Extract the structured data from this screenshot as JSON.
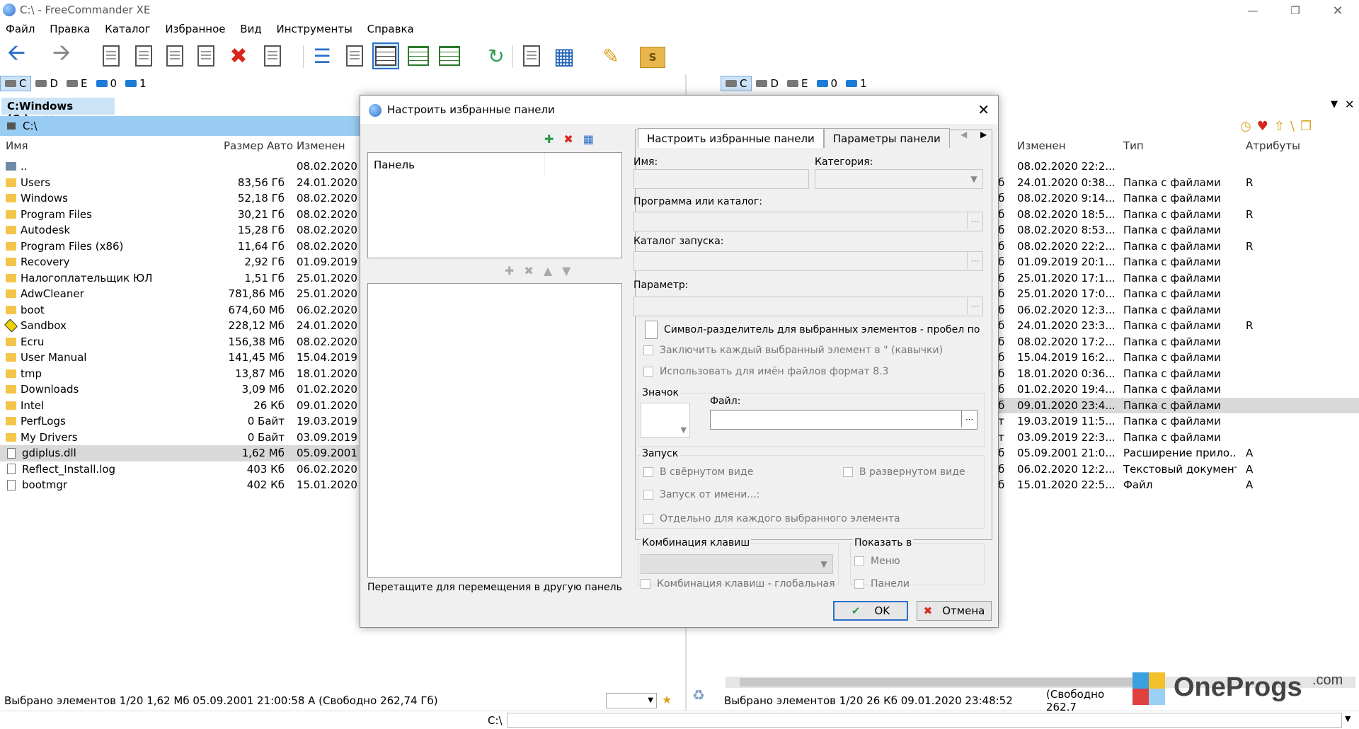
{
  "window": {
    "title": "C:\\ - FreeCommander XE"
  },
  "menu": [
    "Файл",
    "Правка",
    "Каталог",
    "Избранное",
    "Вид",
    "Инструменты",
    "Справка"
  ],
  "drives": [
    "C",
    "D",
    "E",
    "0",
    "1"
  ],
  "left_panel": {
    "tab": "C:Windows (C:)",
    "path": "C:\\",
    "headers": {
      "name": "Имя",
      "size": "Размер Авто",
      "modified": "Изменен"
    },
    "rows": [
      {
        "name": "..",
        "size": "",
        "date": "08.02.2020",
        "type": "up"
      },
      {
        "name": "Users",
        "size": "83,56 Гб",
        "date": "24.01.2020",
        "type": "folder"
      },
      {
        "name": "Windows",
        "size": "52,18 Гб",
        "date": "08.02.2020",
        "type": "folder"
      },
      {
        "name": "Program Files",
        "size": "30,21 Гб",
        "date": "08.02.2020",
        "type": "folder"
      },
      {
        "name": "Autodesk",
        "size": "15,28 Гб",
        "date": "08.02.2020",
        "type": "folder"
      },
      {
        "name": "Program Files (x86)",
        "size": "11,64 Гб",
        "date": "08.02.2020",
        "type": "folder"
      },
      {
        "name": "Recovery",
        "size": "2,92 Гб",
        "date": "01.09.2019",
        "type": "folder"
      },
      {
        "name": "Налогоплательщик ЮЛ",
        "size": "1,51 Гб",
        "date": "25.01.2020",
        "type": "folder"
      },
      {
        "name": "AdwCleaner",
        "size": "781,86 Мб",
        "date": "25.01.2020",
        "type": "folder"
      },
      {
        "name": "boot",
        "size": "674,60 Мб",
        "date": "06.02.2020",
        "type": "folder"
      },
      {
        "name": "Sandbox",
        "size": "228,12 Мб",
        "date": "24.01.2020",
        "type": "sandbox"
      },
      {
        "name": "Ecru",
        "size": "156,38 Мб",
        "date": "08.02.2020",
        "type": "folder"
      },
      {
        "name": "User Manual",
        "size": "141,45 Мб",
        "date": "15.04.2019",
        "type": "folder"
      },
      {
        "name": "tmp",
        "size": "13,87 Мб",
        "date": "18.01.2020",
        "type": "folder"
      },
      {
        "name": "Downloads",
        "size": "3,09 Мб",
        "date": "01.02.2020",
        "type": "folder"
      },
      {
        "name": "Intel",
        "size": "26 Кб",
        "date": "09.01.2020",
        "type": "folder"
      },
      {
        "name": "PerfLogs",
        "size": "0 Байт",
        "date": "19.03.2019",
        "type": "folder"
      },
      {
        "name": "My Drivers",
        "size": "0 Байт",
        "date": "03.09.2019",
        "type": "folder"
      },
      {
        "name": "gdiplus.dll",
        "size": "1,62 Мб",
        "date": "05.09.2001",
        "type": "file"
      },
      {
        "name": "Reflect_Install.log",
        "size": "403 Кб",
        "date": "06.02.2020",
        "type": "file"
      },
      {
        "name": "bootmgr",
        "size": "402 Кб",
        "date": "15.01.2020",
        "type": "file"
      }
    ],
    "status": "Выбрано элементов 1/20   1,62 Мб   05.09.2001 21:00:58   A   (Свободно 262,74 Гб)"
  },
  "right_panel": {
    "headers": {
      "mod": "Изменен",
      "type": "Тип",
      "attr": "Атрибуты"
    },
    "rows": [
      {
        "c": "",
        "date": "08.02.2020 22:2...",
        "type": "",
        "attr": ""
      },
      {
        "c": "б",
        "date": "24.01.2020 0:38...",
        "type": "Папка с файлами",
        "attr": "R"
      },
      {
        "c": "б",
        "date": "08.02.2020 9:14...",
        "type": "Папка с файлами",
        "attr": ""
      },
      {
        "c": "б",
        "date": "08.02.2020 18:5...",
        "type": "Папка с файлами",
        "attr": "R"
      },
      {
        "c": "б",
        "date": "08.02.2020 8:53...",
        "type": "Папка с файлами",
        "attr": ""
      },
      {
        "c": "б",
        "date": "08.02.2020 22:2...",
        "type": "Папка с файлами",
        "attr": "R"
      },
      {
        "c": "б",
        "date": "01.09.2019 20:1...",
        "type": "Папка с файлами",
        "attr": ""
      },
      {
        "c": "б",
        "date": "25.01.2020 17:1...",
        "type": "Папка с файлами",
        "attr": ""
      },
      {
        "c": "б",
        "date": "25.01.2020 17:0...",
        "type": "Папка с файлами",
        "attr": ""
      },
      {
        "c": "б",
        "date": "06.02.2020 12:3...",
        "type": "Папка с файлами",
        "attr": ""
      },
      {
        "c": "б",
        "date": "24.01.2020 23:3...",
        "type": "Папка с файлами",
        "attr": "R"
      },
      {
        "c": "б",
        "date": "08.02.2020 17:2...",
        "type": "Папка с файлами",
        "attr": ""
      },
      {
        "c": "б",
        "date": "15.04.2019 16:2...",
        "type": "Папка с файлами",
        "attr": ""
      },
      {
        "c": "б",
        "date": "18.01.2020 0:36...",
        "type": "Папка с файлами",
        "attr": ""
      },
      {
        "c": "б",
        "date": "01.02.2020 19:4...",
        "type": "Папка с файлами",
        "attr": ""
      },
      {
        "c": "б",
        "date": "09.01.2020 23:4...",
        "type": "Папка с файлами",
        "attr": ""
      },
      {
        "c": "т",
        "date": "19.03.2019 11:5...",
        "type": "Папка с файлами",
        "attr": ""
      },
      {
        "c": "т",
        "date": "03.09.2019 22:3...",
        "type": "Папка с файлами",
        "attr": ""
      },
      {
        "c": "б",
        "date": "05.09.2001 21:0...",
        "type": "Расширение прило...",
        "attr": "A"
      },
      {
        "c": "б",
        "date": "06.02.2020 12:2...",
        "type": "Текстовый документ",
        "attr": "A"
      },
      {
        "c": "б",
        "date": "15.01.2020 22:5...",
        "type": "Файл",
        "attr": "A"
      }
    ],
    "status": "Выбрано элементов 1/20   26 Кб   09.01.2020 23:48:52",
    "free": "(Свободно 262,7"
  },
  "bottom_path": "C:\\",
  "dialog": {
    "title": "Настроить избранные панели",
    "panel_col": "Панель",
    "hint": "Перетащите для перемещения в другую панель",
    "tabs": [
      "Настроить избранные панели",
      "Параметры панели"
    ],
    "name_label": "Имя:",
    "category_label": "Категория:",
    "program_label": "Программа или каталог:",
    "startdir_label": "Каталог запуска:",
    "param_label": "Параметр:",
    "chk_sep": "Символ-разделитель для выбранных элементов - пробел по умол",
    "chk_quotes": "Заключить каждый выбранный элемент в \" (кавычки)",
    "chk_83": "Использовать для имён файлов формат 8.3",
    "icon_label": "Значок",
    "file_label": "Файл:",
    "launch_label": "Запуск",
    "chk_min": "В свёрнутом виде",
    "chk_max": "В развернутом виде",
    "chk_runas": "Запуск от имени...:",
    "chk_each": "Отдельно для каждого выбранного элемента",
    "hotkey_label": "Комбинация клавиш",
    "chk_global": "Комбинация клавиш - глобальная",
    "show_label": "Показать в",
    "chk_menu": "Меню",
    "chk_panels": "Панели",
    "ok": "OK",
    "cancel": "Отмена"
  },
  "watermark": {
    "brand": "OneProgs",
    "suffix": ".com"
  },
  "colors": {
    "selection": "#cce4f7",
    "path_bar": "#99ccf2",
    "folder": "#f3c64a",
    "accent": "#2b6fc9"
  }
}
